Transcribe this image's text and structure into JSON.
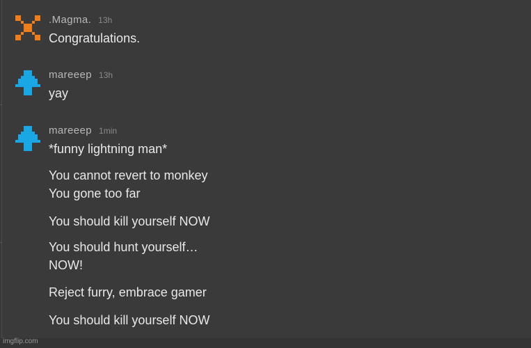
{
  "messages": [
    {
      "username": ".Magma.",
      "time": "13h",
      "avatar_icon": "orange-x-pixel-icon",
      "avatar_color": "#f07f1b",
      "lines": [
        "Congratulations."
      ]
    },
    {
      "username": "mareeep",
      "time": "13h",
      "avatar_icon": "blue-pixel-figure-icon",
      "avatar_color": "#1aa7e6",
      "lines": [
        "yay"
      ]
    },
    {
      "username": "mareeep",
      "time": "1min",
      "avatar_icon": "blue-pixel-figure-icon",
      "avatar_color": "#1aa7e6",
      "lines": [
        "*funny lightning man*",
        "You cannot revert to monkey",
        "You gone too far",
        "You should kill yourself NOW",
        "You should hunt yourself…",
        "NOW!",
        "Reject furry, embrace gamer",
        "You should kill yourself NOW"
      ]
    }
  ],
  "watermark": "imgflip.com",
  "colors": {
    "background": "#3a3a3a",
    "username": "#b9b9b9",
    "timestamp": "#8a8a8a",
    "text": "#e8e8e8"
  }
}
